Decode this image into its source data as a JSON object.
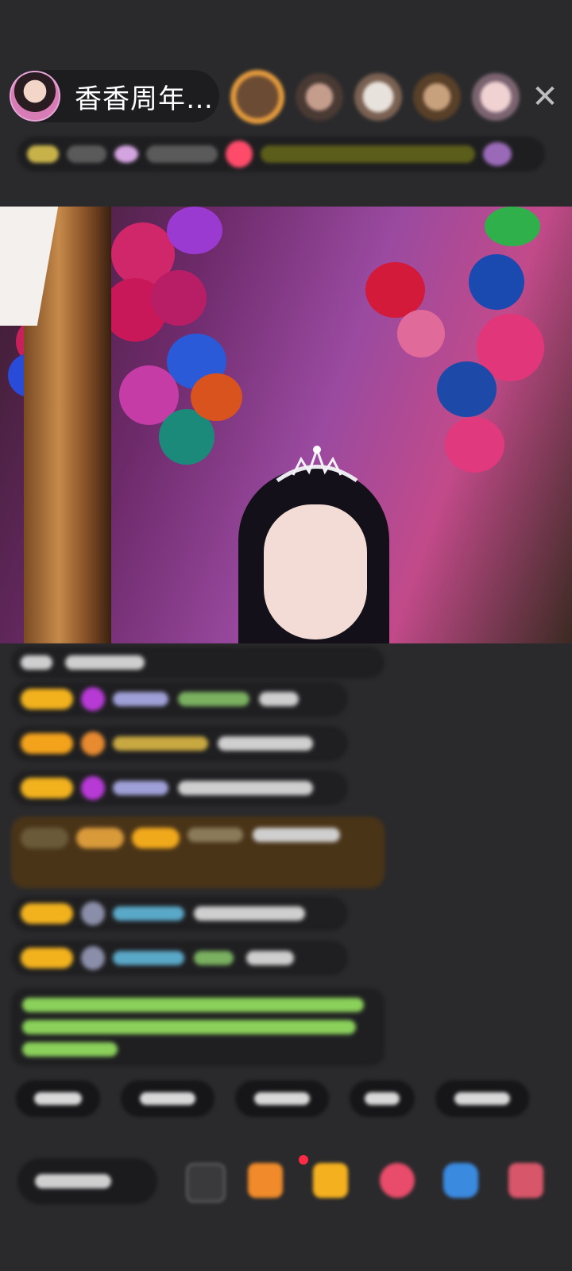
{
  "header": {
    "host_name": "香香周年…",
    "close_icon": "close-icon"
  },
  "colors": {
    "background": "#2a2a2c",
    "badge": "#f2b21e",
    "highlight_bg": "#4a3418",
    "notice_text": "#8ad05a"
  }
}
